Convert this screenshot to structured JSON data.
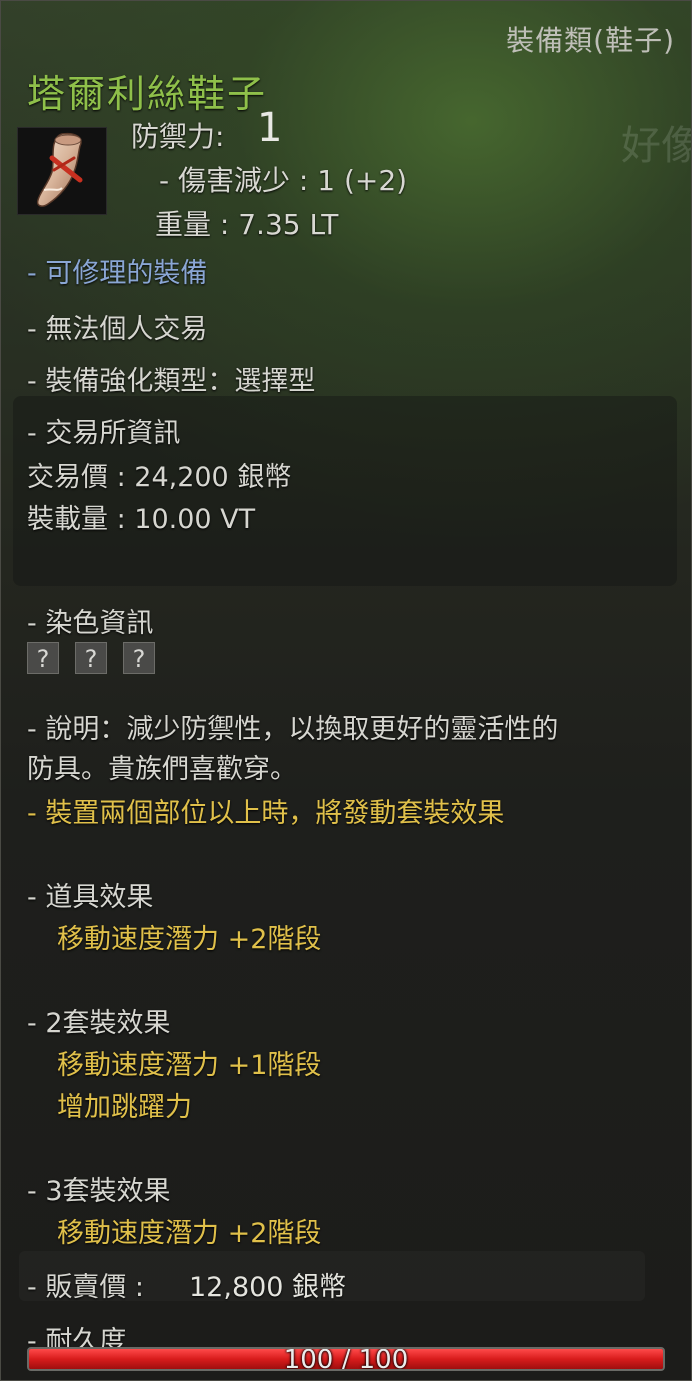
{
  "item": {
    "category": "裝備類(鞋子)",
    "name": "塔爾利絲鞋子",
    "ghost_text": "好像",
    "icon": "shoe-icon"
  },
  "stats": {
    "defense_label": "防禦力:",
    "defense_value": "1",
    "damage_reduction": "- 傷害減少 : 1 (+2)",
    "weight": "重量 : 7.35 LT"
  },
  "properties": {
    "repairable": "- 可修理的裝備",
    "no_trade": "- 無法個人交易",
    "enhance_type": "- 裝備強化類型：選擇型"
  },
  "market": {
    "header": "- 交易所資訊",
    "price": "交易價 : 24,200 銀幣",
    "weight": "裝載量 : 10.00 VT"
  },
  "dye": {
    "header": "- 染色資訊",
    "slots": [
      "?",
      "?",
      "?"
    ]
  },
  "description": {
    "line1": "- 說明：減少防禦性，以換取更好的靈活性的",
    "line2": "防具。貴族們喜歡穿。",
    "set_notice": "- 裝置兩個部位以上時，將發動套裝效果"
  },
  "effects": {
    "item_header": "- 道具效果",
    "item_effect": "移動速度潛力 +2階段",
    "set2_header": "- 2套裝效果",
    "set2_effect1": "移動速度潛力 +1階段",
    "set2_effect2": "增加跳躍力",
    "set3_header": "- 3套裝效果",
    "set3_effect": "移動速度潛力 +2階段"
  },
  "sell": {
    "label": "- 販賣價 :",
    "value": "12,800 銀幣"
  },
  "durability": {
    "label": "- 耐久度",
    "text": "100 / 100",
    "fraction": 1.0
  },
  "colors": {
    "title": "#8fc04a",
    "blue": "#8aa6d4",
    "gold": "#e0c04a",
    "durability": "#d81c1c"
  }
}
